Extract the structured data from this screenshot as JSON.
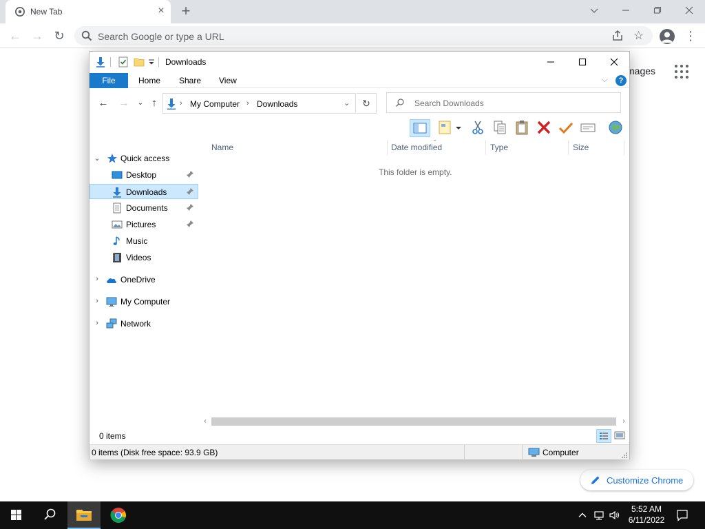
{
  "chrome": {
    "tab_title": "New Tab",
    "omnibox_placeholder": "Search Google or type a URL",
    "ntp_images_link": "mages",
    "customize_label": "Customize Chrome"
  },
  "explorer": {
    "title": "Downloads",
    "ribbon": {
      "file": "File",
      "home": "Home",
      "share": "Share",
      "view": "View",
      "help": "?"
    },
    "breadcrumb": [
      "My Computer",
      "Downloads"
    ],
    "search_placeholder": "Search Downloads",
    "nav": {
      "quick_access": "Quick access",
      "desktop": "Desktop",
      "downloads": "Downloads",
      "documents": "Documents",
      "pictures": "Pictures",
      "music": "Music",
      "videos": "Videos",
      "onedrive": "OneDrive",
      "my_computer": "My Computer",
      "network": "Network"
    },
    "columns": {
      "name": "Name",
      "date": "Date modified",
      "type": "Type",
      "size": "Size"
    },
    "empty_message": "This folder is empty.",
    "items_count": "0 items",
    "status_text": "0 items (Disk free space: 93.9 GB)",
    "status_location": "Computer"
  },
  "taskbar": {
    "time": "5:52 AM",
    "date": "6/11/2022"
  },
  "colors": {
    "accent": "#1979ca",
    "selection": "#cce8ff",
    "link": "#1a73e8"
  }
}
